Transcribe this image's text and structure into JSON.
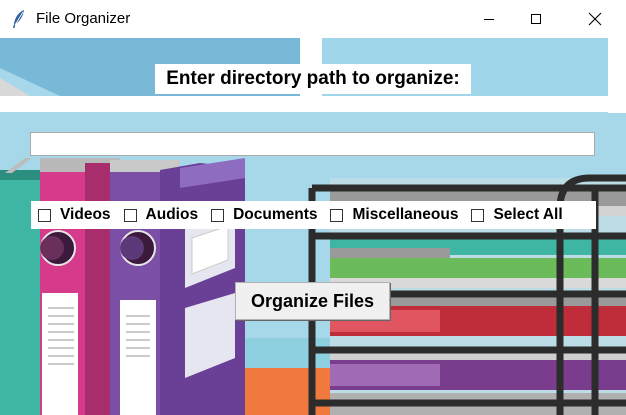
{
  "window": {
    "title": "File Organizer",
    "icon": "feather-icon",
    "controls": {
      "minimize": "minimize-icon",
      "maximize": "maximize-icon",
      "close": "close-icon"
    }
  },
  "form": {
    "prompt_label": "Enter directory path to organize:",
    "path_value": "",
    "options": [
      {
        "label": "Videos",
        "checked": false
      },
      {
        "label": "Audios",
        "checked": false
      },
      {
        "label": "Documents",
        "checked": false
      },
      {
        "label": "Miscellaneous",
        "checked": false
      },
      {
        "label": "Select All",
        "checked": false
      }
    ],
    "organize_button": "Organize Files"
  },
  "colors": {
    "sky": "#a6d8ea",
    "floor": "#8ecfe0",
    "binder_purple": "#7b4fa6",
    "binder_pink": "#d63a8a",
    "binder_teal": "#3fb6a3",
    "shelf": "#2c2c2c",
    "orange_floor": "#f07a3e"
  }
}
